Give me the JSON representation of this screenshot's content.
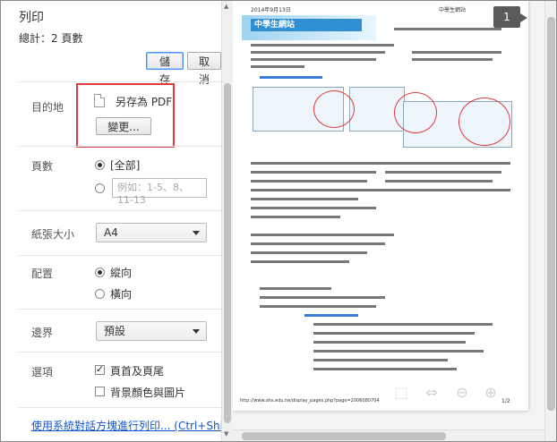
{
  "header": {
    "title": "列印",
    "summary": "總計：2 頁數"
  },
  "actions": {
    "save": "儲存",
    "cancel": "取消"
  },
  "destination": {
    "label": "目的地",
    "printer": "另存為 PDF",
    "change": "變更..."
  },
  "pages": {
    "label": "頁數",
    "all": "[全部]",
    "placeholder": "例如：1-5、8、11-13"
  },
  "paper": {
    "label": "紙張大小",
    "value": "A4"
  },
  "layout": {
    "label": "配置",
    "portrait": "縱向",
    "landscape": "橫向"
  },
  "margins": {
    "label": "邊界",
    "value": "預設"
  },
  "options": {
    "label": "選項",
    "headers_footers": "頁首及頁尾",
    "background": "背景顏色與圖片"
  },
  "system_dialog": "使用系統對話方塊進行列印... (Ctrl+Shift+P)",
  "preview": {
    "page_number": "1",
    "header_date": "2014年9月13日",
    "header_site": "中學生網站",
    "logo_text": "中學生網站",
    "footer_url": "http://www.ahs.edu.tw/display_pages.php?page=2006080704",
    "footer_page": "1/2"
  },
  "colors": {
    "highlight": "#e0393e",
    "link": "#1155cc",
    "accent": "#4d90fe"
  }
}
